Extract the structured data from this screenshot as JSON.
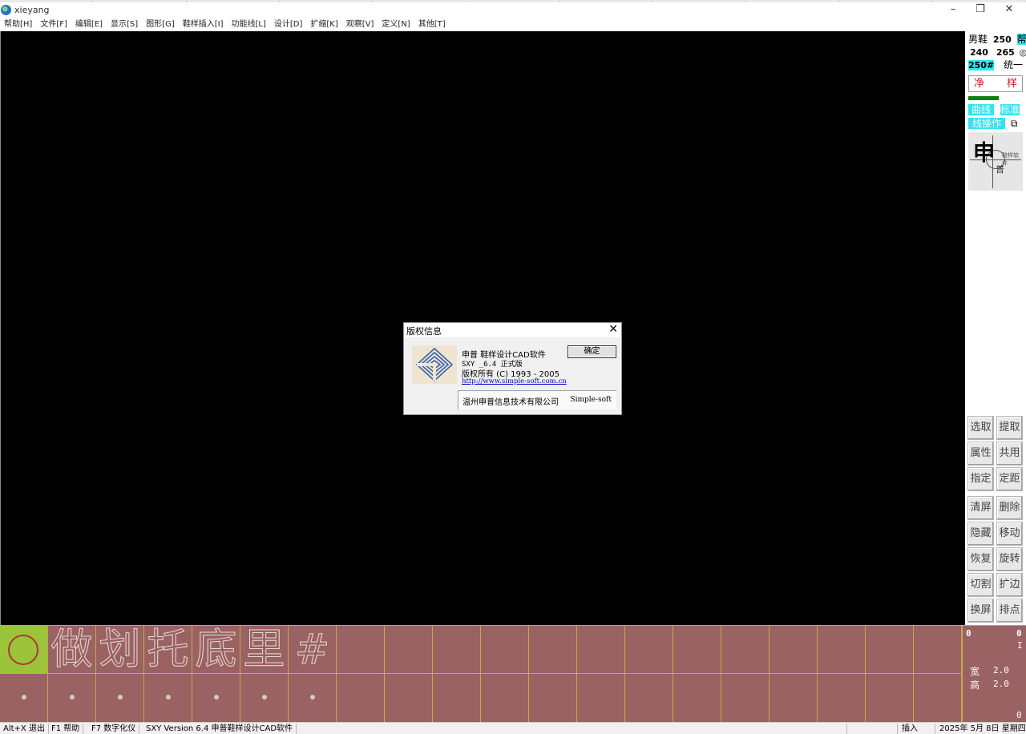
{
  "window": {
    "title": "xieyang",
    "controls": [
      "–",
      "❐",
      "✕"
    ]
  },
  "menu": [
    "帮助[H]",
    "文件[F]",
    "编辑[E]",
    "显示[S]",
    "图形[G]",
    "鞋样插入[I]",
    "功能线[L]",
    "设计[D]",
    "扩缩[K]",
    "观察[V]",
    "定义[N]",
    "其他[T]"
  ],
  "right_panel": {
    "shoe_type": "男鞋",
    "size": "250",
    "bang_tag": "帮",
    "size_low": "240",
    "size_high": "265",
    "size_code": "250#",
    "unify": "统一",
    "clean_left": "净",
    "clean_right": "样",
    "curve": "曲线",
    "standard": "标准",
    "line_op": "线操作",
    "logo_big": "申",
    "logo_small": "普",
    "logo_tiny": "鞋样软件",
    "tools": [
      "选取",
      "提取",
      "属性",
      "共用",
      "指定",
      "定距",
      "清屏",
      "删除",
      "隐藏",
      "移动",
      "恢复",
      "旋转",
      "切割",
      "扩边",
      "换屏",
      "排点"
    ]
  },
  "palette": {
    "glyphs": [
      "",
      "做",
      "划",
      "托",
      "底",
      "里",
      "#"
    ],
    "columns": 20
  },
  "info": {
    "top_left": "0",
    "top_right": "0",
    "cursor_mark": "I",
    "width_label": "宽",
    "width_value": "2.0",
    "height_label": "高",
    "height_value": "2.0",
    "bottom_right": "0"
  },
  "status": {
    "exit": "Alt+X 退出",
    "help": "F1 帮助",
    "digitizer": "F7 数字化仪",
    "version": "SXY Version 6.4 申普鞋样设计CAD软件",
    "insert": "插入",
    "date": "2025年 5月 8日 星期四"
  },
  "dialog": {
    "title": "版权信息",
    "close": "✕",
    "product": "申普 鞋样设计CAD软件",
    "version": "SXY _6.4    正式版",
    "copyright": "版权所有 (C) 1993 - 2005",
    "url": "http://www.simple-soft.com.cn",
    "ok": "确定",
    "company": "温州申普信息技术有限公司",
    "brand": "Simple-soft"
  }
}
